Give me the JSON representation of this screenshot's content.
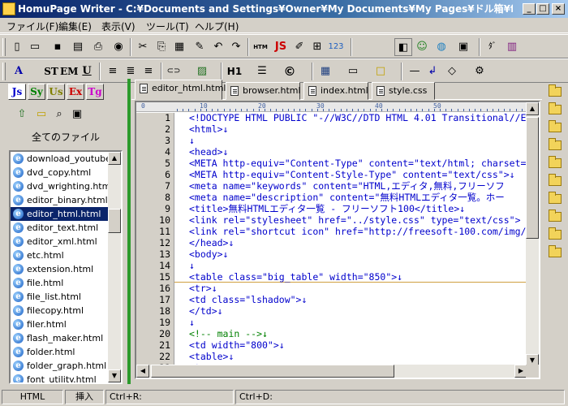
{
  "window": {
    "title": "HomuPage Writer - C:¥Documents and Settings¥Owner¥My Documents¥My Pages¥ドル箱¥freesoft¥pa...",
    "minimize": "_",
    "maximize": "□",
    "close": "×"
  },
  "menu": [
    {
      "label": "ファイル(F)"
    },
    {
      "label": "編集(E)"
    },
    {
      "label": "表示(V)"
    },
    {
      "label": "ツール(T)"
    },
    {
      "label": "ヘルプ(H)"
    }
  ],
  "toolbar1": [
    {
      "glyph": "▯",
      "icon": "new-file-icon"
    },
    {
      "glyph": "▭",
      "icon": "open-folder-icon"
    },
    {
      "glyph": "▪",
      "icon": "save-icon"
    },
    {
      "glyph": "▤",
      "icon": "save-all-icon"
    },
    {
      "glyph": "⎙",
      "icon": "print-icon"
    },
    {
      "glyph": "◉",
      "icon": "preview-icon"
    },
    {
      "glyph": "✂",
      "icon": "cut-icon"
    },
    {
      "glyph": "⎘",
      "icon": "copy-icon"
    },
    {
      "glyph": "▦",
      "icon": "paste-icon"
    },
    {
      "glyph": "✎",
      "icon": "edit-icon"
    },
    {
      "glyph": "↶",
      "icon": "undo-icon"
    },
    {
      "glyph": "↷",
      "icon": "redo-icon"
    },
    {
      "glyph": "HTM",
      "icon": "html-icon"
    },
    {
      "glyph": "JS",
      "icon": "javascript-icon"
    },
    {
      "glyph": "✐",
      "icon": "note-icon"
    },
    {
      "glyph": "⊞",
      "icon": "grid-icon"
    },
    {
      "glyph": "123",
      "icon": "numbering-icon"
    },
    {
      "glyph": "◧",
      "icon": "split-view-icon"
    },
    {
      "glyph": "☺",
      "icon": "smiley-icon"
    },
    {
      "glyph": "◍",
      "icon": "globe-icon"
    },
    {
      "glyph": "▣",
      "icon": "window-icon"
    },
    {
      "glyph": "ﾀﾞ",
      "icon": "convert-icon"
    },
    {
      "glyph": "▥",
      "icon": "tool-icon"
    }
  ],
  "toolbar2": [
    {
      "glyph": "A",
      "icon": "font-color-icon"
    },
    {
      "glyph": "ST",
      "icon": "strong-icon"
    },
    {
      "glyph": "EM",
      "icon": "emphasis-icon"
    },
    {
      "glyph": "U",
      "icon": "underline-icon"
    },
    {
      "glyph": "≡",
      "icon": "align-left-icon"
    },
    {
      "glyph": "≣",
      "icon": "align-center-icon"
    },
    {
      "glyph": "≡",
      "icon": "align-right-icon"
    },
    {
      "glyph": "⊂⊃",
      "icon": "link-icon"
    },
    {
      "glyph": "▨",
      "icon": "image-icon"
    },
    {
      "glyph": "H1",
      "icon": "heading-icon"
    },
    {
      "glyph": "☰",
      "icon": "list-icon"
    },
    {
      "glyph": "©",
      "icon": "special-char-icon"
    },
    {
      "glyph": "▦",
      "icon": "table-icon"
    },
    {
      "glyph": "▭",
      "icon": "form-icon"
    },
    {
      "glyph": "□",
      "icon": "box-icon"
    },
    {
      "glyph": "—",
      "icon": "hr-icon"
    },
    {
      "glyph": "↲",
      "icon": "br-icon"
    },
    {
      "glyph": "◇",
      "icon": "comment-icon"
    },
    {
      "glyph": "⚙",
      "icon": "tag-tool-icon"
    }
  ],
  "panel": {
    "tabs": [
      {
        "label": "Js",
        "color": "#0000cc"
      },
      {
        "label": "Sy",
        "color": "#008000"
      },
      {
        "label": "Us",
        "color": "#808000"
      },
      {
        "label": "Ex",
        "color": "#cc0000"
      },
      {
        "label": "Tg",
        "color": "#cc00cc"
      }
    ],
    "all_files_label": "全てのファイル",
    "files": [
      {
        "name": "download_youtube.h"
      },
      {
        "name": "dvd_copy.html"
      },
      {
        "name": "dvd_wrighting.html"
      },
      {
        "name": "editor_binary.html"
      },
      {
        "name": "editor_html.html"
      },
      {
        "name": "editor_text.html"
      },
      {
        "name": "editor_xml.html"
      },
      {
        "name": "etc.html"
      },
      {
        "name": "extension.html"
      },
      {
        "name": "file.html"
      },
      {
        "name": "file_list.html"
      },
      {
        "name": "filecopy.html"
      },
      {
        "name": "filer.html"
      },
      {
        "name": "flash_maker.html"
      },
      {
        "name": "folder.html"
      },
      {
        "name": "folder_graph.html"
      },
      {
        "name": "font_utility.html"
      }
    ],
    "selected_index": 4
  },
  "tabs": [
    {
      "label": "editor_html.html",
      "active": true
    },
    {
      "label": "browser.html",
      "active": false
    },
    {
      "label": "index.html",
      "active": false
    },
    {
      "label": "style.css",
      "active": false
    }
  ],
  "ruler": [
    "0",
    "10",
    "20",
    "30",
    "40",
    "50"
  ],
  "code_lines": [
    {
      "n": "1",
      "t": "<!DOCTYPE HTML PUBLIC \"-//W3C//DTD HTML 4.01 Transitional//E"
    },
    {
      "n": "2",
      "t": "<html>↓"
    },
    {
      "n": "3",
      "t": "↓"
    },
    {
      "n": "4",
      "t": "<head>↓"
    },
    {
      "n": "5",
      "t": "<META http-equiv=\"Content-Type\" content=\"text/html; charset="
    },
    {
      "n": "6",
      "t": "<META http-equiv=\"Content-Style-Type\" content=\"text/css\">↓"
    },
    {
      "n": "7",
      "t": "<meta name=\"keywords\" content=\"HTML,エディタ,無料,フリーソフ"
    },
    {
      "n": "8",
      "t": "<meta name=\"description\" content=\"無料HTMLエディタ一覧。ホー"
    },
    {
      "n": "9",
      "t": "<title>無料HTMLエディタ一覧 - フリーソフト100</title>↓"
    },
    {
      "n": "10",
      "t": "<link rel=\"stylesheet\" href=\"../style.css\" type=\"text/css\">"
    },
    {
      "n": "11",
      "t": "<link rel=\"shortcut icon\" href=\"http://freesoft-100.com/img/"
    },
    {
      "n": "12",
      "t": "</head>↓"
    },
    {
      "n": "13",
      "t": "<body>↓"
    },
    {
      "n": "14",
      "t": "↓"
    },
    {
      "n": "15",
      "t": "<table class=\"big_table\" width=\"850\">↓"
    },
    {
      "n": "16",
      "t": "<tr>↓"
    },
    {
      "n": "17",
      "t": "<td class=\"lshadow\">↓"
    },
    {
      "n": "18",
      "t": "</td>↓"
    },
    {
      "n": "19",
      "t": "↓"
    },
    {
      "n": "20",
      "t": "<!-- main -->↓",
      "comment": true
    },
    {
      "n": "21",
      "t": "<td width=\"800\">↓"
    },
    {
      "n": "22",
      "t": "<table>↓"
    },
    {
      "n": "23",
      "t": "<tr>↓"
    }
  ],
  "status": {
    "mode": "HTML",
    "insert": "挿入",
    "shortcut_r": "Ctrl+R:",
    "shortcut_d": "Ctrl+D:"
  },
  "colors": {
    "title_start": "#0a246a",
    "title_end": "#a6caf0",
    "selection": "#0a246a",
    "code": "#0000cc",
    "comment": "#008000",
    "splitter": "#2c9a2c"
  }
}
